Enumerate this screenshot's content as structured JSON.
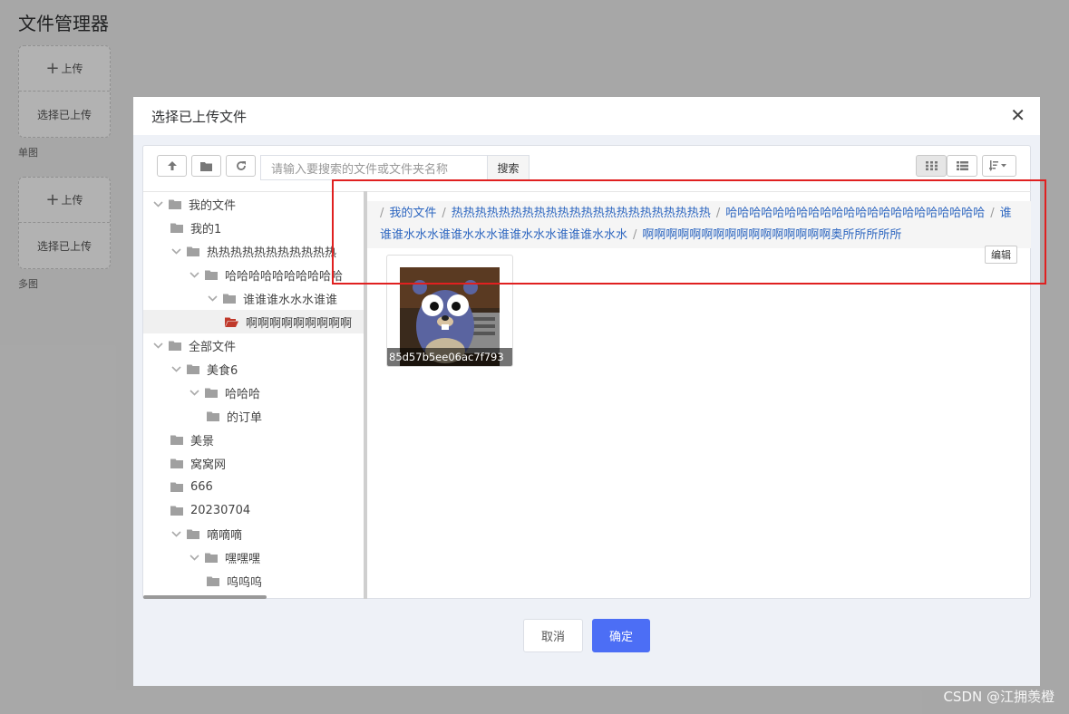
{
  "page": {
    "title": "文件管理器",
    "uploaders": [
      {
        "upload_label": "上传",
        "select_label": "选择已上传",
        "caption": "单图"
      },
      {
        "upload_label": "上传",
        "select_label": "选择已上传",
        "caption": "多图"
      }
    ]
  },
  "dialog": {
    "title": "选择已上传文件",
    "search": {
      "placeholder": "请输入要搜索的文件或文件夹名称",
      "button": "搜索"
    },
    "tree": [
      {
        "label": "我的文件",
        "expanded": true
      },
      {
        "label": "我的1"
      },
      {
        "label": "热热热热热热热热热热热",
        "expanded": true
      },
      {
        "label": "哈哈哈哈哈哈哈哈哈哈",
        "expanded": true
      },
      {
        "label": "谁谁谁水水水谁谁",
        "expanded": true
      },
      {
        "label": "啊啊啊啊啊啊啊啊啊",
        "active": true
      },
      {
        "label": "全部文件",
        "expanded": true
      },
      {
        "label": "美食6",
        "expanded": true
      },
      {
        "label": "哈哈哈",
        "expanded": true
      },
      {
        "label": "的订单"
      },
      {
        "label": "美景"
      },
      {
        "label": "窝窝网"
      },
      {
        "label": "666"
      },
      {
        "label": "20230704"
      },
      {
        "label": "嘀嘀嘀",
        "expanded": true
      },
      {
        "label": "嘿嘿嘿",
        "expanded": true
      },
      {
        "label": "呜呜呜"
      }
    ],
    "breadcrumb": [
      "我的文件",
      "热热热热热热热热热热热热热热热热热热热热热热",
      "哈哈哈哈哈哈哈哈哈哈哈哈哈哈哈哈哈哈哈哈哈哈",
      "谁谁谁水水水谁谁水水水谁谁水水水谁谁谁水水水",
      "啊啊啊啊啊啊啊啊啊啊啊啊啊啊啊啊奥所所所所所"
    ],
    "edit_label": "编辑",
    "files": [
      {
        "name": "85d57b5ee06ac7f793"
      }
    ],
    "cancel_label": "取消",
    "confirm_label": "确定"
  },
  "watermark": "CSDN @江拥羡橙",
  "colors": {
    "accent": "#4c6ef5",
    "link": "#2d66c0",
    "highlight": "#e02020",
    "folder_active": "#c0392b"
  }
}
